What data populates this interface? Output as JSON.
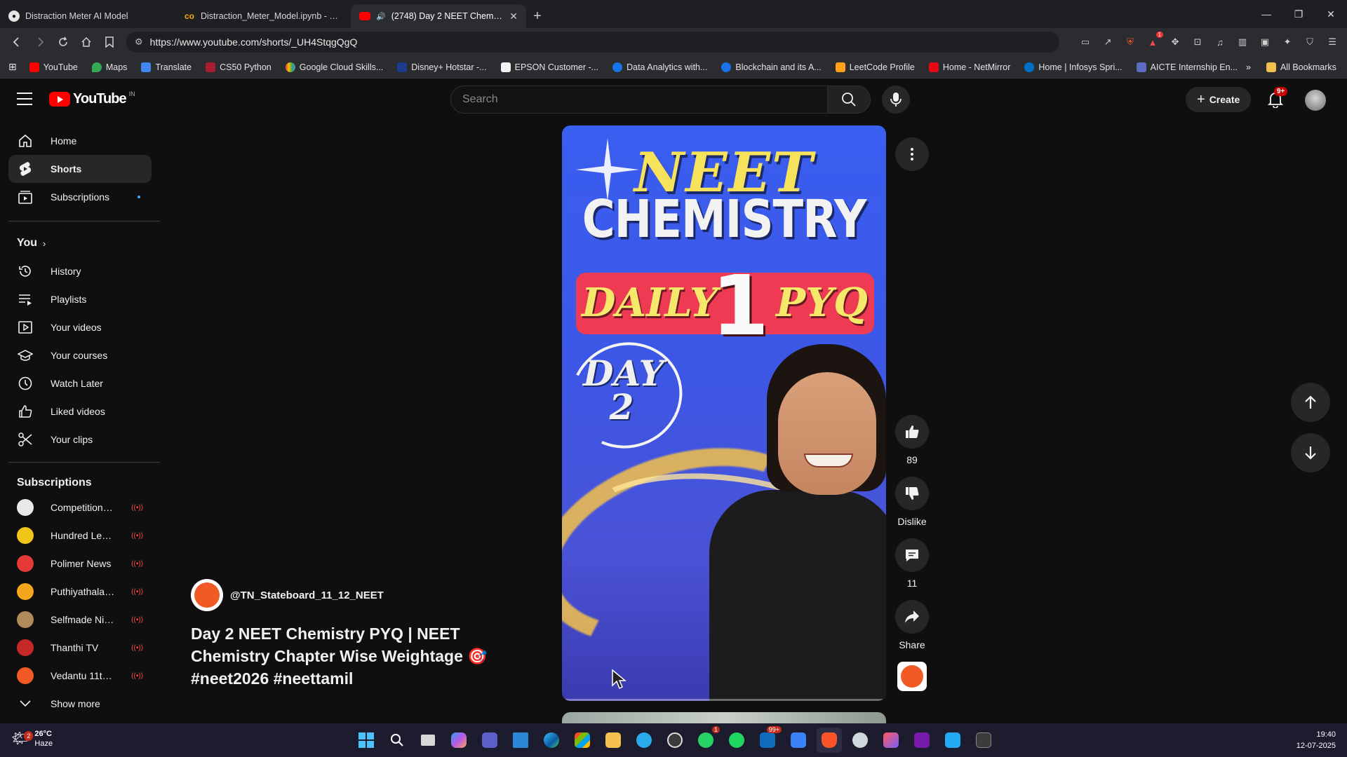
{
  "browser": {
    "tabs": [
      {
        "title": "Distraction Meter AI Model",
        "icon": "github-icon"
      },
      {
        "title": "Distraction_Meter_Model.ipynb - Col...",
        "icon": "colab-icon"
      },
      {
        "title": "(2748) Day 2 NEET Chemistry",
        "icon": "youtube-icon"
      }
    ],
    "url": "https://www.youtube.com/shorts/_UH4StqgQgQ",
    "bookmarks": [
      "YouTube",
      "Maps",
      "Translate",
      "CS50 Python",
      "Google Cloud Skills...",
      "Disney+ Hotstar -...",
      "EPSON Customer -...",
      "Data Analytics with...",
      "Blockchain and its A...",
      "LeetCode Profile",
      "Home - NetMirror",
      "Home | Infosys Spri...",
      "AICTE Internship En..."
    ],
    "all_bookmarks": "All Bookmarks",
    "ext_badge": "1"
  },
  "youtube": {
    "logo_text": "YouTube",
    "country": "IN",
    "search_placeholder": "Search",
    "create_label": "Create",
    "notif_count": "9+",
    "sidebar": {
      "main": [
        {
          "label": "Home",
          "icon": "home-icon"
        },
        {
          "label": "Shorts",
          "icon": "shorts-icon"
        },
        {
          "label": "Subscriptions",
          "icon": "subscriptions-icon"
        }
      ],
      "you_heading": "You",
      "you_items": [
        {
          "label": "History",
          "icon": "history-icon"
        },
        {
          "label": "Playlists",
          "icon": "playlists-icon"
        },
        {
          "label": "Your videos",
          "icon": "your-videos-icon"
        },
        {
          "label": "Your courses",
          "icon": "courses-icon"
        },
        {
          "label": "Watch Later",
          "icon": "clock-icon"
        },
        {
          "label": "Liked videos",
          "icon": "thumbs-up-icon"
        },
        {
          "label": "Your clips",
          "icon": "scissors-icon"
        }
      ],
      "subs_heading": "Subscriptions",
      "subs": [
        {
          "name": "Competition Wall...",
          "color": "#e8e8e8"
        },
        {
          "name": "Hundred Learnin...",
          "color": "#f0c419"
        },
        {
          "name": "Polimer News",
          "color": "#e53935"
        },
        {
          "name": "Puthiyathalaimur...",
          "color": "#f4a61d"
        },
        {
          "name": "Selfmade Ninja ...",
          "color": "#b08a5a"
        },
        {
          "name": "Thanthi TV",
          "color": "#c62828"
        },
        {
          "name": "Vedantu 11th 12...",
          "color": "#f15a24"
        }
      ],
      "show_more": "Show more"
    },
    "short": {
      "art_title1": "NEET",
      "art_title2": "CHEMISTRY",
      "art_daily": "DAILY",
      "art_number": "1",
      "art_pyq": "PYQ",
      "art_day": "DAY",
      "art_day_number": "2",
      "channel_handle": "@TN_Stateboard_11_12_NEET",
      "title": "Day 2 NEET Chemistry PYQ | NEET Chemistry Chapter Wise Weightage 🎯 #neet2026 #neettamil",
      "likes": "89",
      "dislike_label": "Dislike",
      "comments": "11",
      "share_label": "Share"
    }
  },
  "taskbar": {
    "weather_temp": "26°C",
    "weather_desc": "Haze",
    "weather_badge": "2",
    "whatsapp_badge": "1",
    "mail_badge": "99+",
    "time": "19:40",
    "date": "12-07-2025"
  }
}
